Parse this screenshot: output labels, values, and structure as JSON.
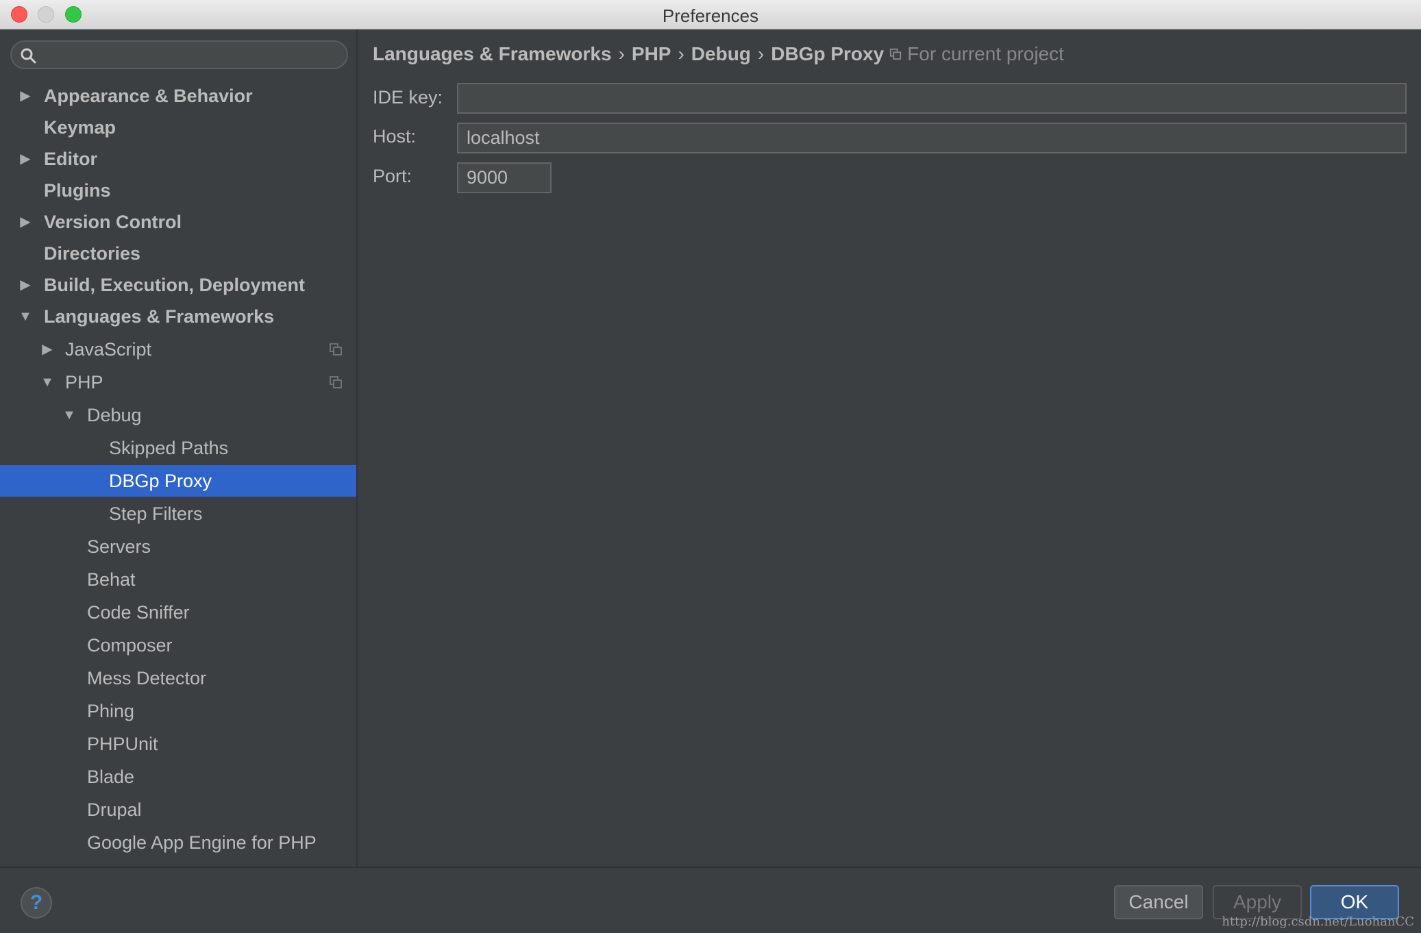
{
  "window": {
    "title": "Preferences"
  },
  "search": {
    "placeholder": "",
    "value": ""
  },
  "sidebar": {
    "items": [
      {
        "label": "Appearance & Behavior",
        "arrow": "right"
      },
      {
        "label": "Keymap",
        "arrow": "none"
      },
      {
        "label": "Editor",
        "arrow": "right"
      },
      {
        "label": "Plugins",
        "arrow": "none"
      },
      {
        "label": "Version Control",
        "arrow": "right"
      },
      {
        "label": "Directories",
        "arrow": "none"
      },
      {
        "label": "Build, Execution, Deployment",
        "arrow": "right"
      },
      {
        "label": "Languages & Frameworks",
        "arrow": "down"
      },
      {
        "label": "JavaScript",
        "arrow": "right"
      },
      {
        "label": "PHP",
        "arrow": "down"
      },
      {
        "label": "Debug",
        "arrow": "down"
      },
      {
        "label": "Skipped Paths",
        "arrow": "none"
      },
      {
        "label": "DBGp Proxy",
        "arrow": "none",
        "selected": true
      },
      {
        "label": "Step Filters",
        "arrow": "none"
      },
      {
        "label": "Servers",
        "arrow": "none"
      },
      {
        "label": "Behat",
        "arrow": "none"
      },
      {
        "label": "Code Sniffer",
        "arrow": "none"
      },
      {
        "label": "Composer",
        "arrow": "none"
      },
      {
        "label": "Mess Detector",
        "arrow": "none"
      },
      {
        "label": "Phing",
        "arrow": "none"
      },
      {
        "label": "PHPUnit",
        "arrow": "none"
      },
      {
        "label": "Blade",
        "arrow": "none"
      },
      {
        "label": "Drupal",
        "arrow": "none"
      },
      {
        "label": "Google App Engine for PHP",
        "arrow": "none"
      }
    ]
  },
  "breadcrumb": {
    "parts": [
      "Languages & Frameworks",
      "PHP",
      "Debug",
      "DBGp Proxy"
    ],
    "separator": "›",
    "scope_note": "For current project"
  },
  "form": {
    "ide_key": {
      "label": "IDE key:",
      "value": ""
    },
    "host": {
      "label": "Host:",
      "value": "localhost"
    },
    "port": {
      "label": "Port:",
      "value": "9000"
    }
  },
  "buttons": {
    "help": "?",
    "cancel": "Cancel",
    "apply": "Apply",
    "ok": "OK"
  },
  "watermark": "http://blog.csdn.net/LuohanCC",
  "colors": {
    "selection": "#2f65ca",
    "background": "#3c3f41",
    "ok_button": "#365880",
    "help_icon": "#3e90d8"
  },
  "icons": {
    "search": "search-icon",
    "copy": "copy-settings-icon",
    "arrow_right": "triangle-right-icon",
    "arrow_down": "triangle-down-icon"
  }
}
